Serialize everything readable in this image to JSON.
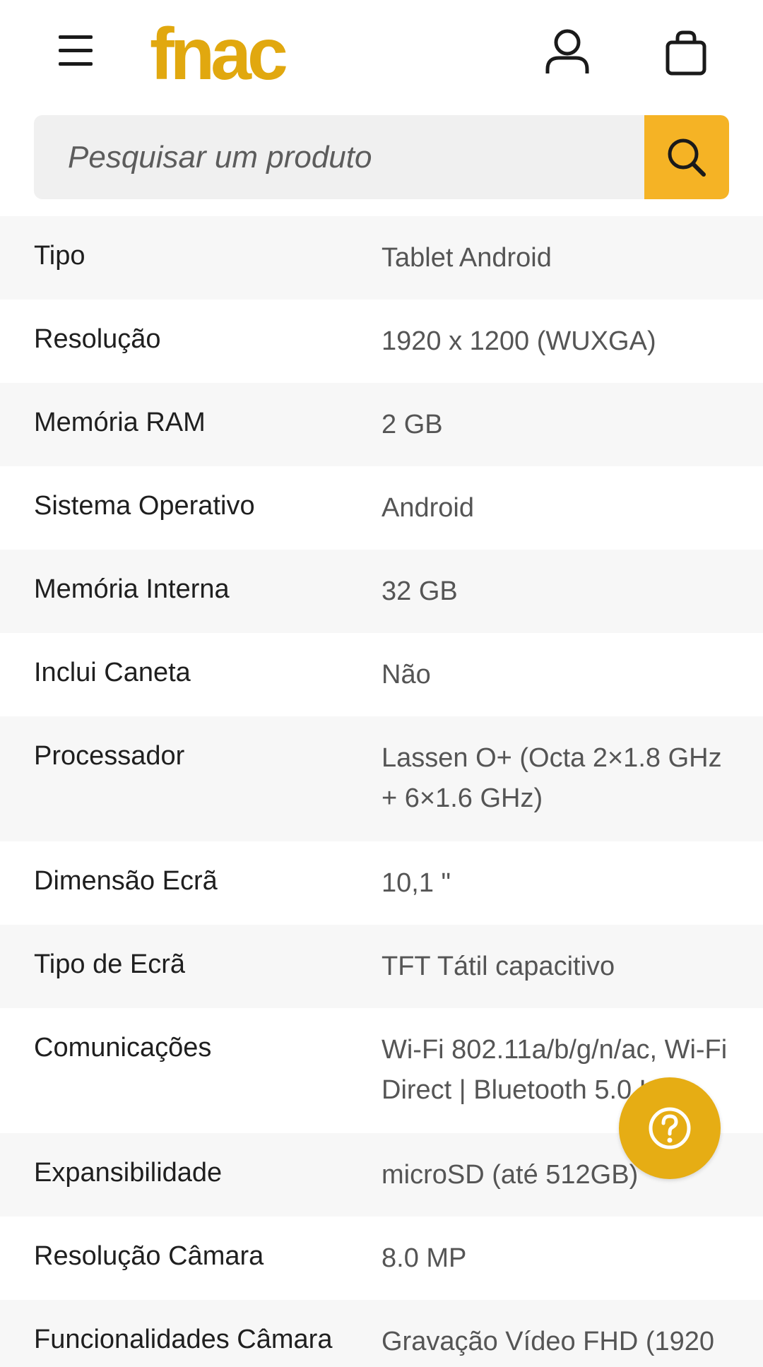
{
  "header": {
    "logo_text": "fnac",
    "brand_color": "#e1a80f",
    "menu_icon": "hamburger-menu-icon",
    "account_icon": "user-icon",
    "cart_icon": "shopping-bag-icon"
  },
  "search": {
    "placeholder": "Pesquisar um produto",
    "button_icon": "search-icon",
    "button_color": "#f5b325"
  },
  "specs": [
    {
      "label": "Tipo",
      "value": "Tablet Android"
    },
    {
      "label": "Resolução",
      "value": "1920 x 1200 (WUXGA)"
    },
    {
      "label": "Memória RAM",
      "value": "2 GB"
    },
    {
      "label": "Sistema Operativo",
      "value": "Android"
    },
    {
      "label": "Memória Interna",
      "value": "32 GB"
    },
    {
      "label": "Inclui Caneta",
      "value": "Não"
    },
    {
      "label": "Processador",
      "value": "Lassen O+ (Octa 2×1.8 GHz + 6×1.6 GHz)"
    },
    {
      "label": "Dimensão Ecrã",
      "value": "10,1 \""
    },
    {
      "label": "Tipo de Ecrã",
      "value": "TFT Tátil capacitivo"
    },
    {
      "label": "Comunicações",
      "value": "Wi-Fi 802.11a/b/g/n/ac, Wi-Fi Direct | Bluetooth 5.0 LE"
    },
    {
      "label": "Expansibilidade",
      "value": "microSD (até 512GB)"
    },
    {
      "label": "Resolução Câmara",
      "value": "8.0 MP"
    },
    {
      "label": "Funcionalidades Câmara",
      "value": "Gravação Vídeo FHD (1920"
    }
  ],
  "help_button": {
    "icon": "help-question-icon",
    "color": "#e6ad14"
  }
}
